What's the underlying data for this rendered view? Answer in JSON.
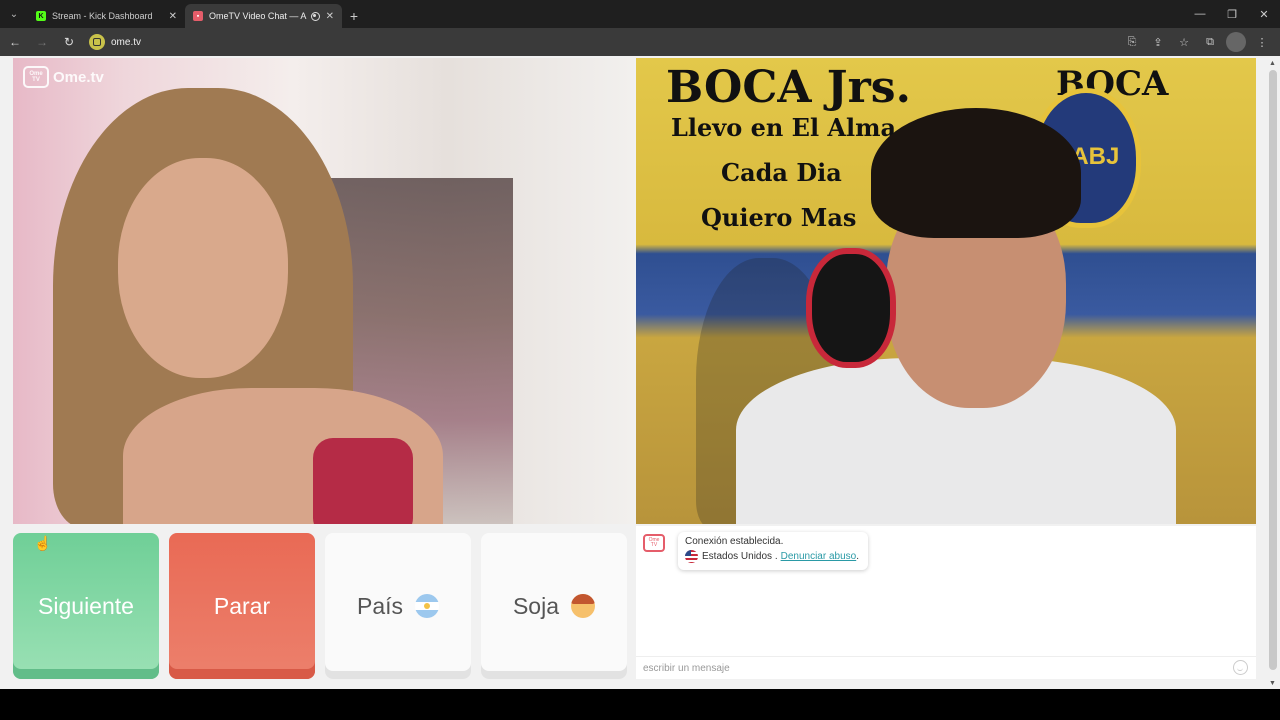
{
  "browser": {
    "tabs": [
      {
        "title": "Stream - Kick Dashboard",
        "favicon": "kick-icon",
        "color": "#53fc18"
      },
      {
        "title": "OmeTV Video Chat — Alter",
        "favicon": "ometv-icon",
        "color": "#e55d6a"
      }
    ],
    "url": "ome.tv"
  },
  "logo": {
    "text": "Ome.tv",
    "badge": "Ome TV"
  },
  "buttons": {
    "next": "Siguiente",
    "stop": "Parar",
    "country": "País",
    "gender": "Soja"
  },
  "chat": {
    "badge": "Ome TV",
    "connected": "Conexión establecida.",
    "country": "Estados Unidos .",
    "report_link": "Denunciar abuso",
    "report_suffix": ".",
    "input_placeholder": "escribir un mensaje"
  },
  "colors": {
    "next": "#6fcf97",
    "stop": "#e96a55",
    "link": "#2a9aa6"
  },
  "video_text": {
    "boca_left": "BOCA Jrs.",
    "boca_right": "BOCA",
    "lyric1": "Llevo en El Alma",
    "lyric2": "Cada Dia",
    "lyric3": "Quiero Mas",
    "crest": "CABJ"
  }
}
